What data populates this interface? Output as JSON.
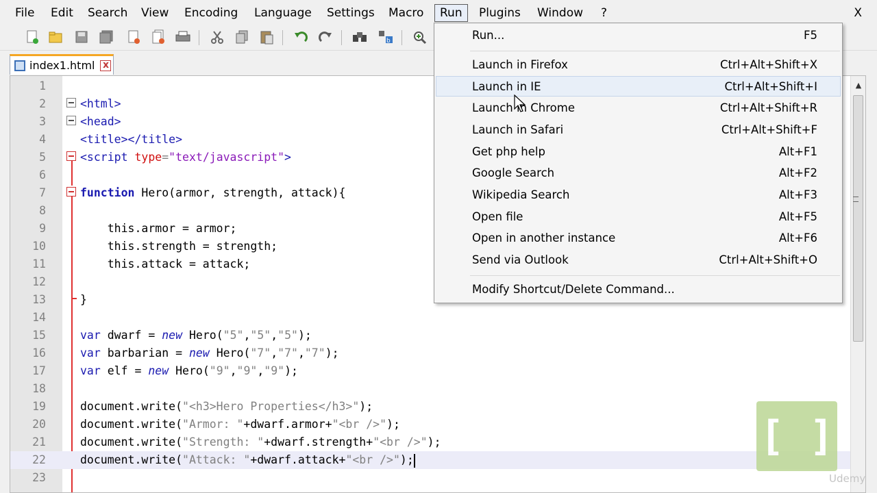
{
  "menubar": {
    "items": [
      "File",
      "Edit",
      "Search",
      "View",
      "Encoding",
      "Language",
      "Settings",
      "Macro",
      "Run",
      "Plugins",
      "Window",
      "?"
    ],
    "close": "X",
    "active": "Run"
  },
  "toolbar": {
    "icons": [
      "new-file-icon",
      "open-file-icon",
      "save-icon",
      "save-all-icon",
      "close-icon",
      "close-all-icon",
      "print-icon",
      "cut-icon",
      "copy-icon",
      "paste-icon",
      "undo-icon",
      "redo-icon",
      "find-icon",
      "replace-icon",
      "zoom-in-icon"
    ]
  },
  "tab": {
    "filename": "index1.html",
    "close": "x"
  },
  "editor": {
    "current_line": 22,
    "lines": [
      {
        "n": "1"
      },
      {
        "n": "2"
      },
      {
        "n": "3"
      },
      {
        "n": "4"
      },
      {
        "n": "5"
      },
      {
        "n": "6"
      },
      {
        "n": "7"
      },
      {
        "n": "8"
      },
      {
        "n": "9"
      },
      {
        "n": "10"
      },
      {
        "n": "11"
      },
      {
        "n": "12"
      },
      {
        "n": "13"
      },
      {
        "n": "14"
      },
      {
        "n": "15"
      },
      {
        "n": "16"
      },
      {
        "n": "17"
      },
      {
        "n": "18"
      },
      {
        "n": "19"
      },
      {
        "n": "20"
      },
      {
        "n": "21"
      },
      {
        "n": "22"
      },
      {
        "n": "23"
      }
    ]
  },
  "run_menu": {
    "items": [
      {
        "label": "Run...",
        "shortcut": "F5"
      },
      {
        "label": "Launch in Firefox",
        "shortcut": "Ctrl+Alt+Shift+X"
      },
      {
        "label": "Launch in IE",
        "shortcut": "Ctrl+Alt+Shift+I"
      },
      {
        "label": "Launch in Chrome",
        "shortcut": "Ctrl+Alt+Shift+R"
      },
      {
        "label": "Launch in Safari",
        "shortcut": "Ctrl+Alt+Shift+F"
      },
      {
        "label": "Get php help",
        "shortcut": "Alt+F1"
      },
      {
        "label": "Google Search",
        "shortcut": "Alt+F2"
      },
      {
        "label": "Wikipedia Search",
        "shortcut": "Alt+F3"
      },
      {
        "label": "Open file",
        "shortcut": "Alt+F5"
      },
      {
        "label": "Open in another instance",
        "shortcut": "Alt+F6"
      },
      {
        "label": "Send via Outlook",
        "shortcut": "Ctrl+Alt+Shift+O"
      },
      {
        "label": "Modify Shortcut/Delete Command...",
        "shortcut": ""
      }
    ],
    "hovered": "Launch in IE"
  },
  "code": {
    "l2": "<html>",
    "l3": "<head>",
    "l4a": "<title>",
    "l4b": "</title>",
    "l5a": "<script",
    "l5b": " type",
    "l5c": "=",
    "l5d": "\"text/javascript\"",
    "l5e": ">",
    "l7a": "function",
    "l7b": " Hero(armor, strength, attack){",
    "l9": "    this.armor = armor;",
    "l10": "    this.strength = strength;",
    "l11": "    this.attack = attack;",
    "l13": "}",
    "l15a": "var",
    "l15b": " dwarf = ",
    "l15c": "new",
    "l15d": " Hero(",
    "l15e": "\"5\"",
    "l15f": ",",
    "l15g": "\"5\"",
    "l15h": ",",
    "l15i": "\"5\"",
    "l15j": ");",
    "l16a": "var",
    "l16b": " barbarian = ",
    "l16c": "new",
    "l16d": " Hero(",
    "l16e": "\"7\"",
    "l16f": ",",
    "l16g": "\"7\"",
    "l16h": ",",
    "l16i": "\"7\"",
    "l16j": ");",
    "l17a": "var",
    "l17b": " elf = ",
    "l17c": "new",
    "l17d": " Hero(",
    "l17e": "\"9\"",
    "l17f": ",",
    "l17g": "\"9\"",
    "l17h": ",",
    "l17i": "\"9\"",
    "l17j": ");",
    "l19a": "document.write(",
    "l19b": "\"<h3>Hero Properties</h3>\"",
    "l19c": ");",
    "l20a": "document.write(",
    "l20b": "\"Armor: \"",
    "l20c": "+dwarf.armor+",
    "l20d": "\"<br />\"",
    "l20e": ");",
    "l21a": "document.write(",
    "l21b": "\"Strength: \"",
    "l21c": "+dwarf.strength+",
    "l21d": "\"<br />\"",
    "l21e": ");",
    "l22a": "document.write(",
    "l22b": "\"Attack: \"",
    "l22c": "+dwarf.attack+",
    "l22d": "\"<br />\"",
    "l22e": ");"
  },
  "watermark": {
    "logo": "[ ]",
    "text": "Udemy"
  }
}
